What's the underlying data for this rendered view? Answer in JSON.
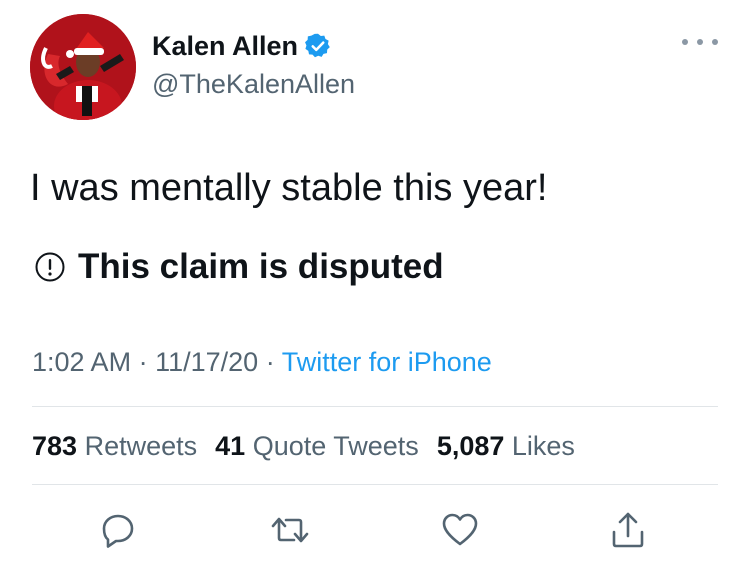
{
  "user": {
    "display_name": "Kalen Allen",
    "handle": "@TheKalenAllen",
    "verified": true
  },
  "tweet": {
    "text": "I was mentally stable this year!",
    "notice": "This claim is disputed",
    "time": "1:02 AM",
    "date": "11/17/20",
    "separator": "·",
    "source": "Twitter for iPhone"
  },
  "stats": {
    "retweets_count": "783",
    "retweets_label": "Retweets",
    "quotes_count": "41",
    "quotes_label": "Quote Tweets",
    "likes_count": "5,087",
    "likes_label": "Likes"
  },
  "icons": {
    "more": "more-icon",
    "reply": "reply-icon",
    "retweet": "retweet-icon",
    "like": "heart-icon",
    "share": "share-icon"
  },
  "colors": {
    "accent": "#1d9bf0",
    "text": "#0f1419",
    "secondary": "#536471",
    "avatar_background": "#b0121b"
  }
}
